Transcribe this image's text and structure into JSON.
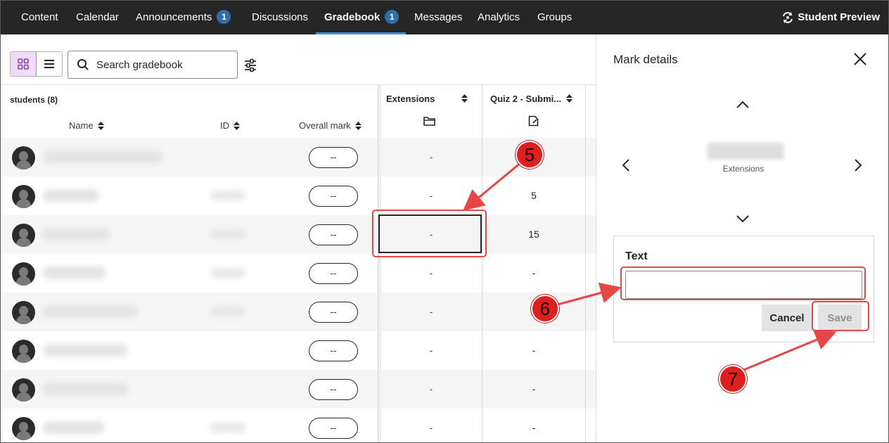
{
  "nav": {
    "items": [
      {
        "label": "Content"
      },
      {
        "label": "Calendar"
      },
      {
        "label": "Announcements",
        "badge": "1"
      },
      {
        "label": "Discussions"
      },
      {
        "label": "Gradebook",
        "badge": "1",
        "active": true
      },
      {
        "label": "Messages"
      },
      {
        "label": "Analytics"
      },
      {
        "label": "Groups"
      }
    ],
    "student_preview": "Student Preview"
  },
  "toolbar": {
    "search_placeholder": "Search gradebook",
    "view_grid_icon": "grid-view-icon",
    "view_list_icon": "list-view-icon",
    "filter_icon": "filter-sliders-icon"
  },
  "grid": {
    "students_header": "students (8)",
    "columns": {
      "name": "Name",
      "id": "ID",
      "overall": "Overall mark",
      "extensions": "Extensions",
      "quiz": "Quiz 2 - Submi..."
    },
    "rows": [
      {
        "overall": "--",
        "extensions": "-",
        "quiz": ""
      },
      {
        "overall": "--",
        "extensions": "-",
        "quiz": "5"
      },
      {
        "overall": "--",
        "extensions": "-",
        "quiz": "15"
      },
      {
        "overall": "--",
        "extensions": "-",
        "quiz": "-"
      },
      {
        "overall": "--",
        "extensions": "-",
        "quiz": ""
      },
      {
        "overall": "--",
        "extensions": "-",
        "quiz": "-"
      },
      {
        "overall": "--",
        "extensions": "-",
        "quiz": "-"
      },
      {
        "overall": "--",
        "extensions": "-",
        "quiz": "-"
      }
    ]
  },
  "panel": {
    "title": "Mark details",
    "column_name": "Extensions",
    "text_label": "Text",
    "text_value": "",
    "cancel_label": "Cancel",
    "save_label": "Save"
  },
  "annotations": {
    "step5": "5",
    "step6": "6",
    "step7": "7",
    "color": "#e64646"
  }
}
